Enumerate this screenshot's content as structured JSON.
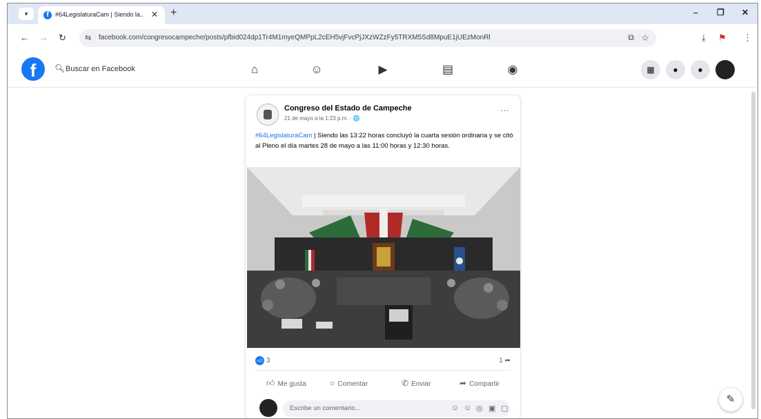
{
  "browser": {
    "menu_label": "▾",
    "tab_title": "#64LegislaturaCam | Siendo la...",
    "tab_close": "✕",
    "new_tab": "+",
    "window_controls": {
      "minimize": "–",
      "maximize": "❐",
      "close": "✕"
    },
    "nav": {
      "back": "←",
      "forward": "→",
      "reload": "↻"
    },
    "url": "facebook.com/congresocampeche/posts/pfbid024dp1Tr4M1myeQMPpL2cEH5vjFvcPjJXzWZzFy5TRXM5Sd8MpuE1jUEzMonRl",
    "site_info": "⇆"
  },
  "facebook": {
    "logo": "f",
    "search_placeholder": "Buscar en Facebook",
    "nav_icons": [
      "home-icon",
      "friends-icon",
      "watch-icon",
      "marketplace-icon",
      "groups-icon"
    ]
  },
  "post": {
    "page_name": "Congreso del Estado de Campeche",
    "date": "21 de mayo a la 1:23 p.m. · 🌐",
    "more": "···",
    "hashtag": "#64LegislaturaCam",
    "text": " | Siendo las 13:22 horas concluyó la cuarta sesión ordinaria y se citó al Pleno el día martes 28 de mayo a las 11:00 horas y 12:30 horas.",
    "reaction_count": "3",
    "share_count": "1",
    "actions": {
      "like": "Me gusta",
      "comment": "Comentar",
      "send": "Enviar",
      "share": "Compartir"
    },
    "comment_placeholder": "Escribe un comentario..."
  },
  "colors": {
    "fb_blue": "#1877f2",
    "tab_strip": "#dfe6f4"
  }
}
